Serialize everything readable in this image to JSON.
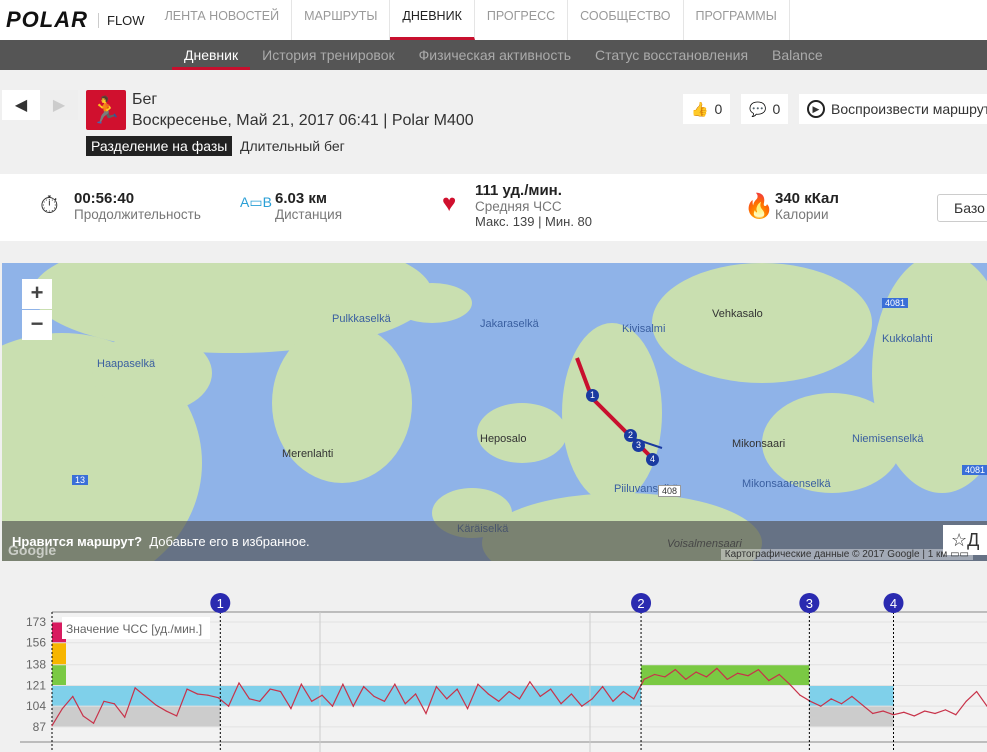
{
  "topnav": {
    "logo": "POLAR",
    "flow": "FLOW",
    "items": [
      "ЛЕНТА НОВОСТЕЙ",
      "МАРШРУТЫ",
      "ДНЕВНИК",
      "ПРОГРЕСС",
      "СООБЩЕСТВО",
      "ПРОГРАММЫ"
    ],
    "active": 2
  },
  "subnav": {
    "items": [
      "Дневник",
      "История тренировок",
      "Физическая активность",
      "Статус восстановления",
      "Balance"
    ],
    "active": 0
  },
  "session": {
    "sport": "Бег",
    "datetime": "Воскресенье, Май 21, 2017 06:41 | Polar M400",
    "phase_label": "Разделение на фазы",
    "type": "Длительный бег",
    "likes": "0",
    "comments": "0",
    "replay": "Воспроизвести маршрут"
  },
  "stats": {
    "duration": "00:56:40",
    "duration_label": "Продолжительность",
    "distance": "6.03 км",
    "distance_label": "Дистанция",
    "hr": "111 уд./мин.",
    "hr_label": "Средняя ЧСС",
    "hr_minmax": "Макс. 139  |  Мин. 80",
    "calories": "340 кКал",
    "calories_label": "Калории",
    "basic": "Базо"
  },
  "map": {
    "labels": [
      "Pulkkaselkä",
      "Jakaraselkä",
      "Kivisalmi",
      "Vehkasalo",
      "Haapaselkä",
      "Heposalo",
      "Merenlahti",
      "Mikonsaari",
      "Niemisenselkä",
      "Mikonsaarenselkä",
      "Kukkolahti",
      "Voisalmensaari",
      "Piiluvanselkä",
      "Käräiselkä"
    ],
    "roads": [
      "4081",
      "13",
      "408",
      "4081"
    ],
    "fav_q": "Нравится маршрут?",
    "fav_text": "Добавьте его в избранное.",
    "fav_btn": "Д",
    "credit": "Картографические данные © 2017 Google",
    "scale": "1 км",
    "zoom_in": "+",
    "zoom_out": "−",
    "google": "Google"
  },
  "colors": {
    "accent": "#c8102e",
    "route": "#c8102e",
    "zone1": "#cccccc",
    "zone2": "#7fd0ea",
    "zone3": "#7ac943",
    "zone4": "#f7b500",
    "zone5": "#d81b60"
  },
  "chart_data": {
    "type": "line",
    "ylabel": "Значение ЧСС [уд./мин.]",
    "yticks": [
      173,
      156,
      138,
      121,
      104,
      87
    ],
    "ylim": [
      80,
      180
    ],
    "laps": [
      "1",
      "2",
      "3",
      "4"
    ],
    "lap_positions": [
      0.18,
      0.63,
      0.81,
      0.9
    ],
    "zones": [
      {
        "from": 87,
        "to": 104
      },
      {
        "from": 104,
        "to": 121
      },
      {
        "from": 121,
        "to": 138
      },
      {
        "from": 138,
        "to": 156
      },
      {
        "from": 156,
        "to": 173
      }
    ],
    "values": [
      88,
      102,
      112,
      96,
      90,
      108,
      106,
      95,
      119,
      112,
      105,
      100,
      96,
      118,
      114,
      113,
      111,
      104,
      123,
      110,
      108,
      118,
      116,
      102,
      122,
      108,
      113,
      104,
      122,
      104,
      120,
      112,
      108,
      122,
      106,
      114,
      98,
      120,
      110,
      118,
      102,
      122,
      114,
      108,
      116,
      110,
      124,
      112,
      118,
      106,
      114,
      104,
      110,
      120,
      108,
      116,
      110,
      126,
      130,
      128,
      134,
      126,
      132,
      128,
      135,
      126,
      131,
      129,
      134,
      125,
      130,
      122,
      113,
      108,
      104,
      110,
      106,
      112,
      105,
      98,
      100,
      97,
      99,
      96,
      100,
      98,
      101,
      97,
      108,
      116,
      104
    ]
  }
}
